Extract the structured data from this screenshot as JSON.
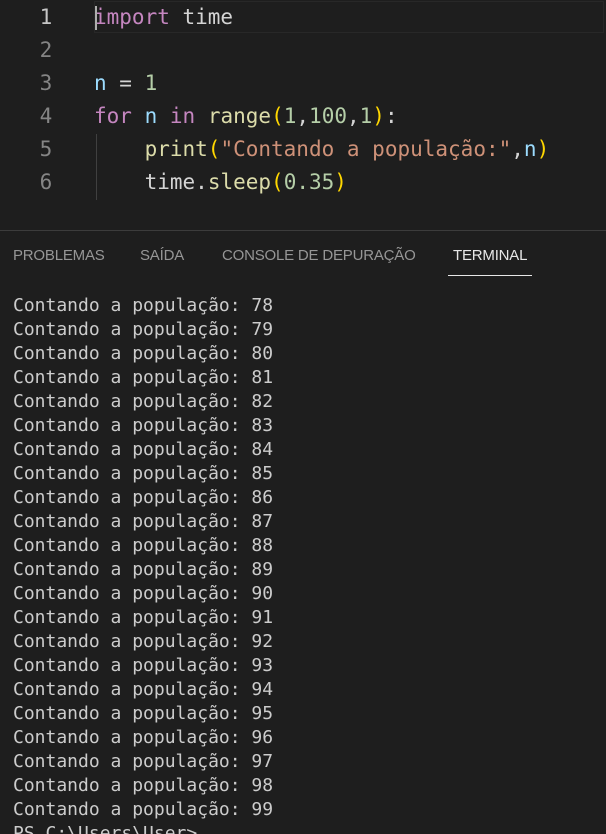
{
  "editor": {
    "lines": [
      {
        "number": "1",
        "tokens": [
          {
            "t": "import",
            "c": "tok-kw"
          },
          {
            "t": " time",
            "c": "tok-plain"
          }
        ]
      },
      {
        "number": "2",
        "tokens": []
      },
      {
        "number": "3",
        "tokens": [
          {
            "t": "n",
            "c": "tok-var"
          },
          {
            "t": " = ",
            "c": "tok-plain"
          },
          {
            "t": "1",
            "c": "tok-num"
          }
        ]
      },
      {
        "number": "4",
        "tokens": [
          {
            "t": "for",
            "c": "tok-ctl"
          },
          {
            "t": " ",
            "c": "tok-plain"
          },
          {
            "t": "n",
            "c": "tok-var"
          },
          {
            "t": " ",
            "c": "tok-plain"
          },
          {
            "t": "in",
            "c": "tok-ctl"
          },
          {
            "t": " ",
            "c": "tok-plain"
          },
          {
            "t": "range",
            "c": "tok-fn"
          },
          {
            "t": "(",
            "c": "tok-br1"
          },
          {
            "t": "1",
            "c": "tok-num"
          },
          {
            "t": ",",
            "c": "tok-plain"
          },
          {
            "t": "100",
            "c": "tok-num"
          },
          {
            "t": ",",
            "c": "tok-plain"
          },
          {
            "t": "1",
            "c": "tok-num"
          },
          {
            "t": ")",
            "c": "tok-br1"
          },
          {
            "t": ":",
            "c": "tok-plain"
          }
        ]
      },
      {
        "number": "5",
        "tokens": [
          {
            "t": "    ",
            "c": "tok-plain"
          },
          {
            "t": "print",
            "c": "tok-fn"
          },
          {
            "t": "(",
            "c": "tok-br1"
          },
          {
            "t": "\"Contando a população:\"",
            "c": "tok-str"
          },
          {
            "t": ",",
            "c": "tok-plain"
          },
          {
            "t": "n",
            "c": "tok-var"
          },
          {
            "t": ")",
            "c": "tok-br1"
          }
        ]
      },
      {
        "number": "6",
        "tokens": [
          {
            "t": "    ",
            "c": "tok-plain"
          },
          {
            "t": "time",
            "c": "tok-plain"
          },
          {
            "t": ".",
            "c": "tok-plain"
          },
          {
            "t": "sleep",
            "c": "tok-fn"
          },
          {
            "t": "(",
            "c": "tok-br1"
          },
          {
            "t": "0.35",
            "c": "tok-num"
          },
          {
            "t": ")",
            "c": "tok-br1"
          }
        ]
      }
    ]
  },
  "panel": {
    "tabs": [
      {
        "label": "PROBLEMAS",
        "active": false
      },
      {
        "label": "SAÍDA",
        "active": false
      },
      {
        "label": "CONSOLE DE DEPURAÇÃO",
        "active": false
      },
      {
        "label": "TERMINAL",
        "active": true
      }
    ]
  },
  "terminal": {
    "lines": [
      "Contando a população: 78",
      "Contando a população: 79",
      "Contando a população: 80",
      "Contando a população: 81",
      "Contando a população: 82",
      "Contando a população: 83",
      "Contando a população: 84",
      "Contando a população: 85",
      "Contando a população: 86",
      "Contando a população: 87",
      "Contando a população: 88",
      "Contando a população: 89",
      "Contando a população: 90",
      "Contando a população: 91",
      "Contando a população: 92",
      "Contando a população: 93",
      "Contando a população: 94",
      "Contando a população: 95",
      "Contando a população: 96",
      "Contando a população: 97",
      "Contando a população: 98",
      "Contando a população: 99",
      "PS C:\\Users\\User> "
    ]
  }
}
